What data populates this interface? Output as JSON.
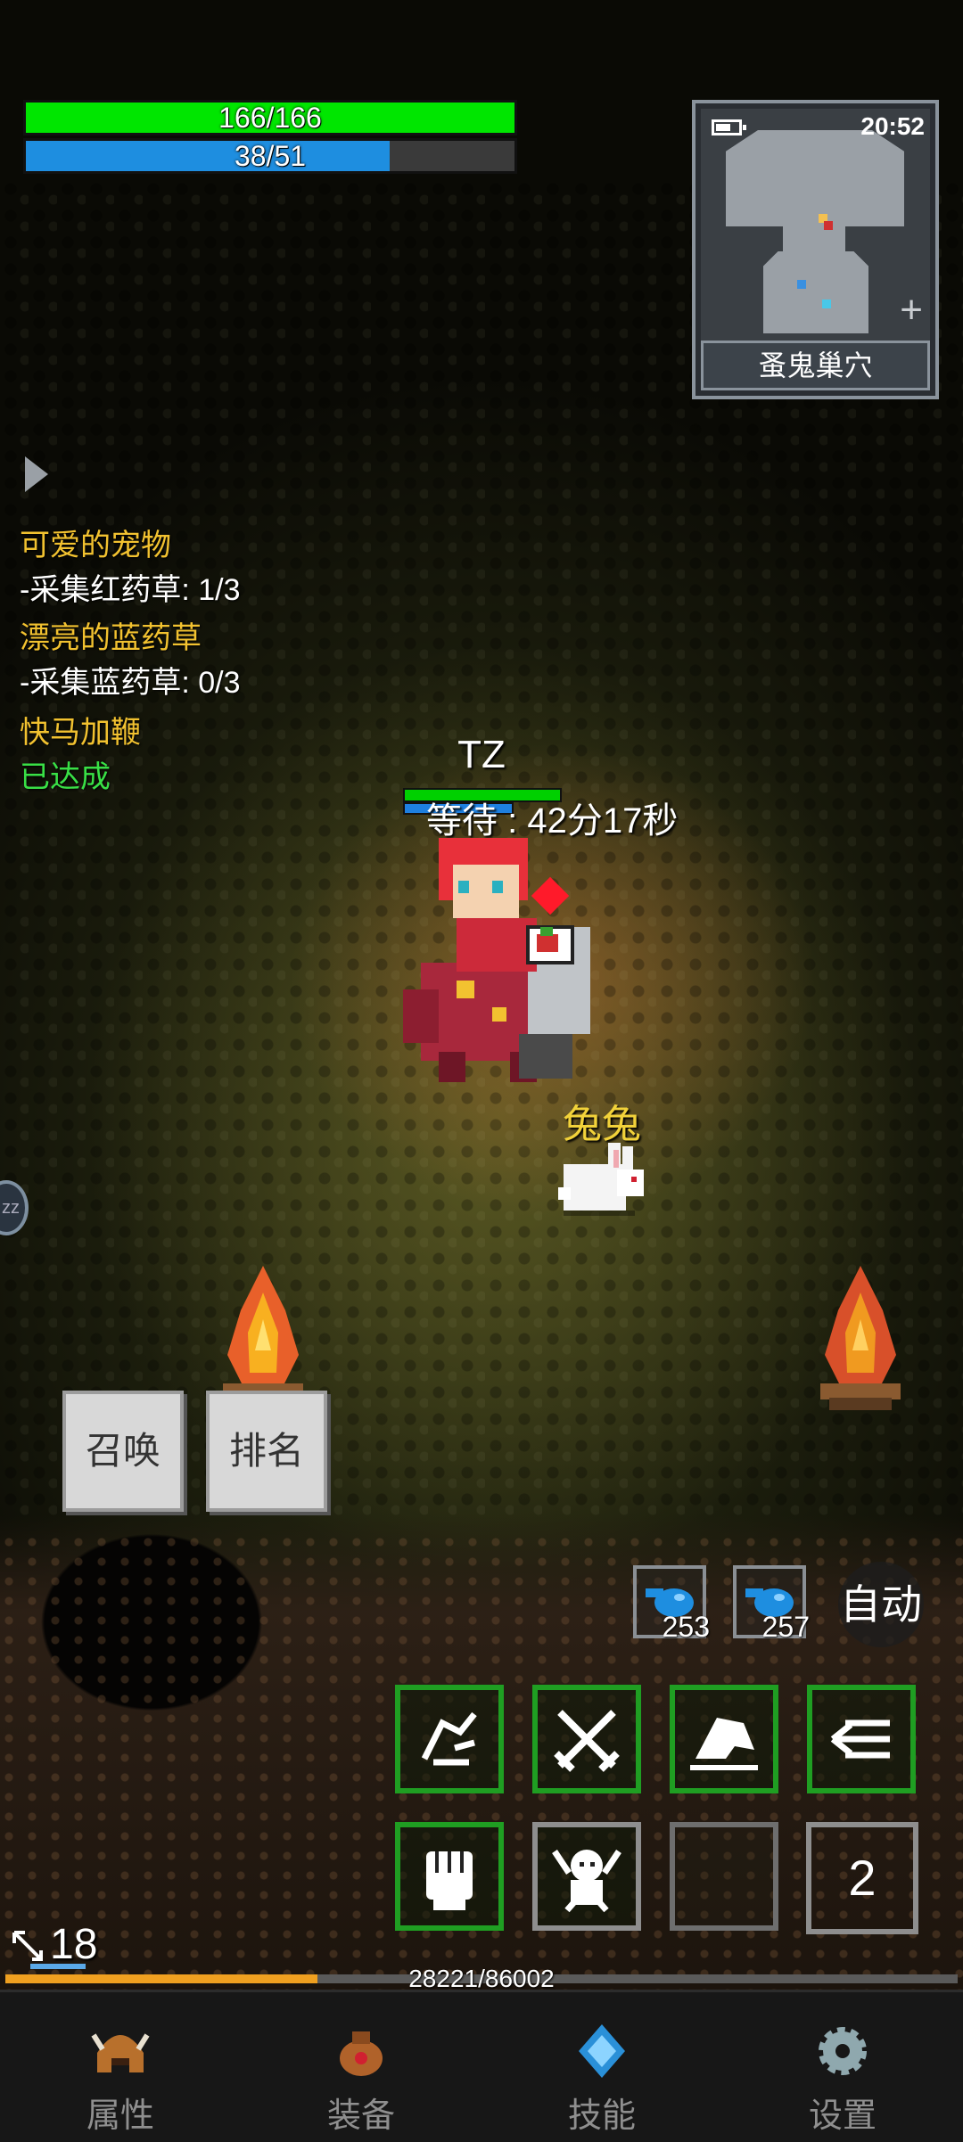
{
  "player": {
    "hp_text": "166/166",
    "hp_frac": 1.0,
    "mp_text": "38/51",
    "mp_frac": 0.745,
    "name": "TZ",
    "wait_text": "等待 : 42分17秒"
  },
  "pet": {
    "name": "兔兔"
  },
  "minimap": {
    "time": "20:52",
    "location": "蚤鬼巢穴"
  },
  "quests": [
    {
      "title": "可爱的宠物",
      "detail": "-采集红药草: 1/3"
    },
    {
      "title": "漂亮的蓝药草",
      "detail": "-采集蓝药草: 0/3"
    },
    {
      "title": "快马加鞭",
      "status": "已达成"
    }
  ],
  "buttons": {
    "summon": "召唤",
    "rank": "排名",
    "auto": "自动"
  },
  "side_handle": "zz",
  "potions": [
    {
      "count": "253"
    },
    {
      "count": "257"
    }
  ],
  "skill_page": "2",
  "level": "18",
  "xp": {
    "text": "28221/86002",
    "frac": 0.328
  },
  "nav": [
    {
      "label": "属性",
      "icon": "helmet-icon"
    },
    {
      "label": "装备",
      "icon": "bag-icon"
    },
    {
      "label": "技能",
      "icon": "crystal-icon"
    },
    {
      "label": "设置",
      "icon": "gear-icon"
    }
  ]
}
